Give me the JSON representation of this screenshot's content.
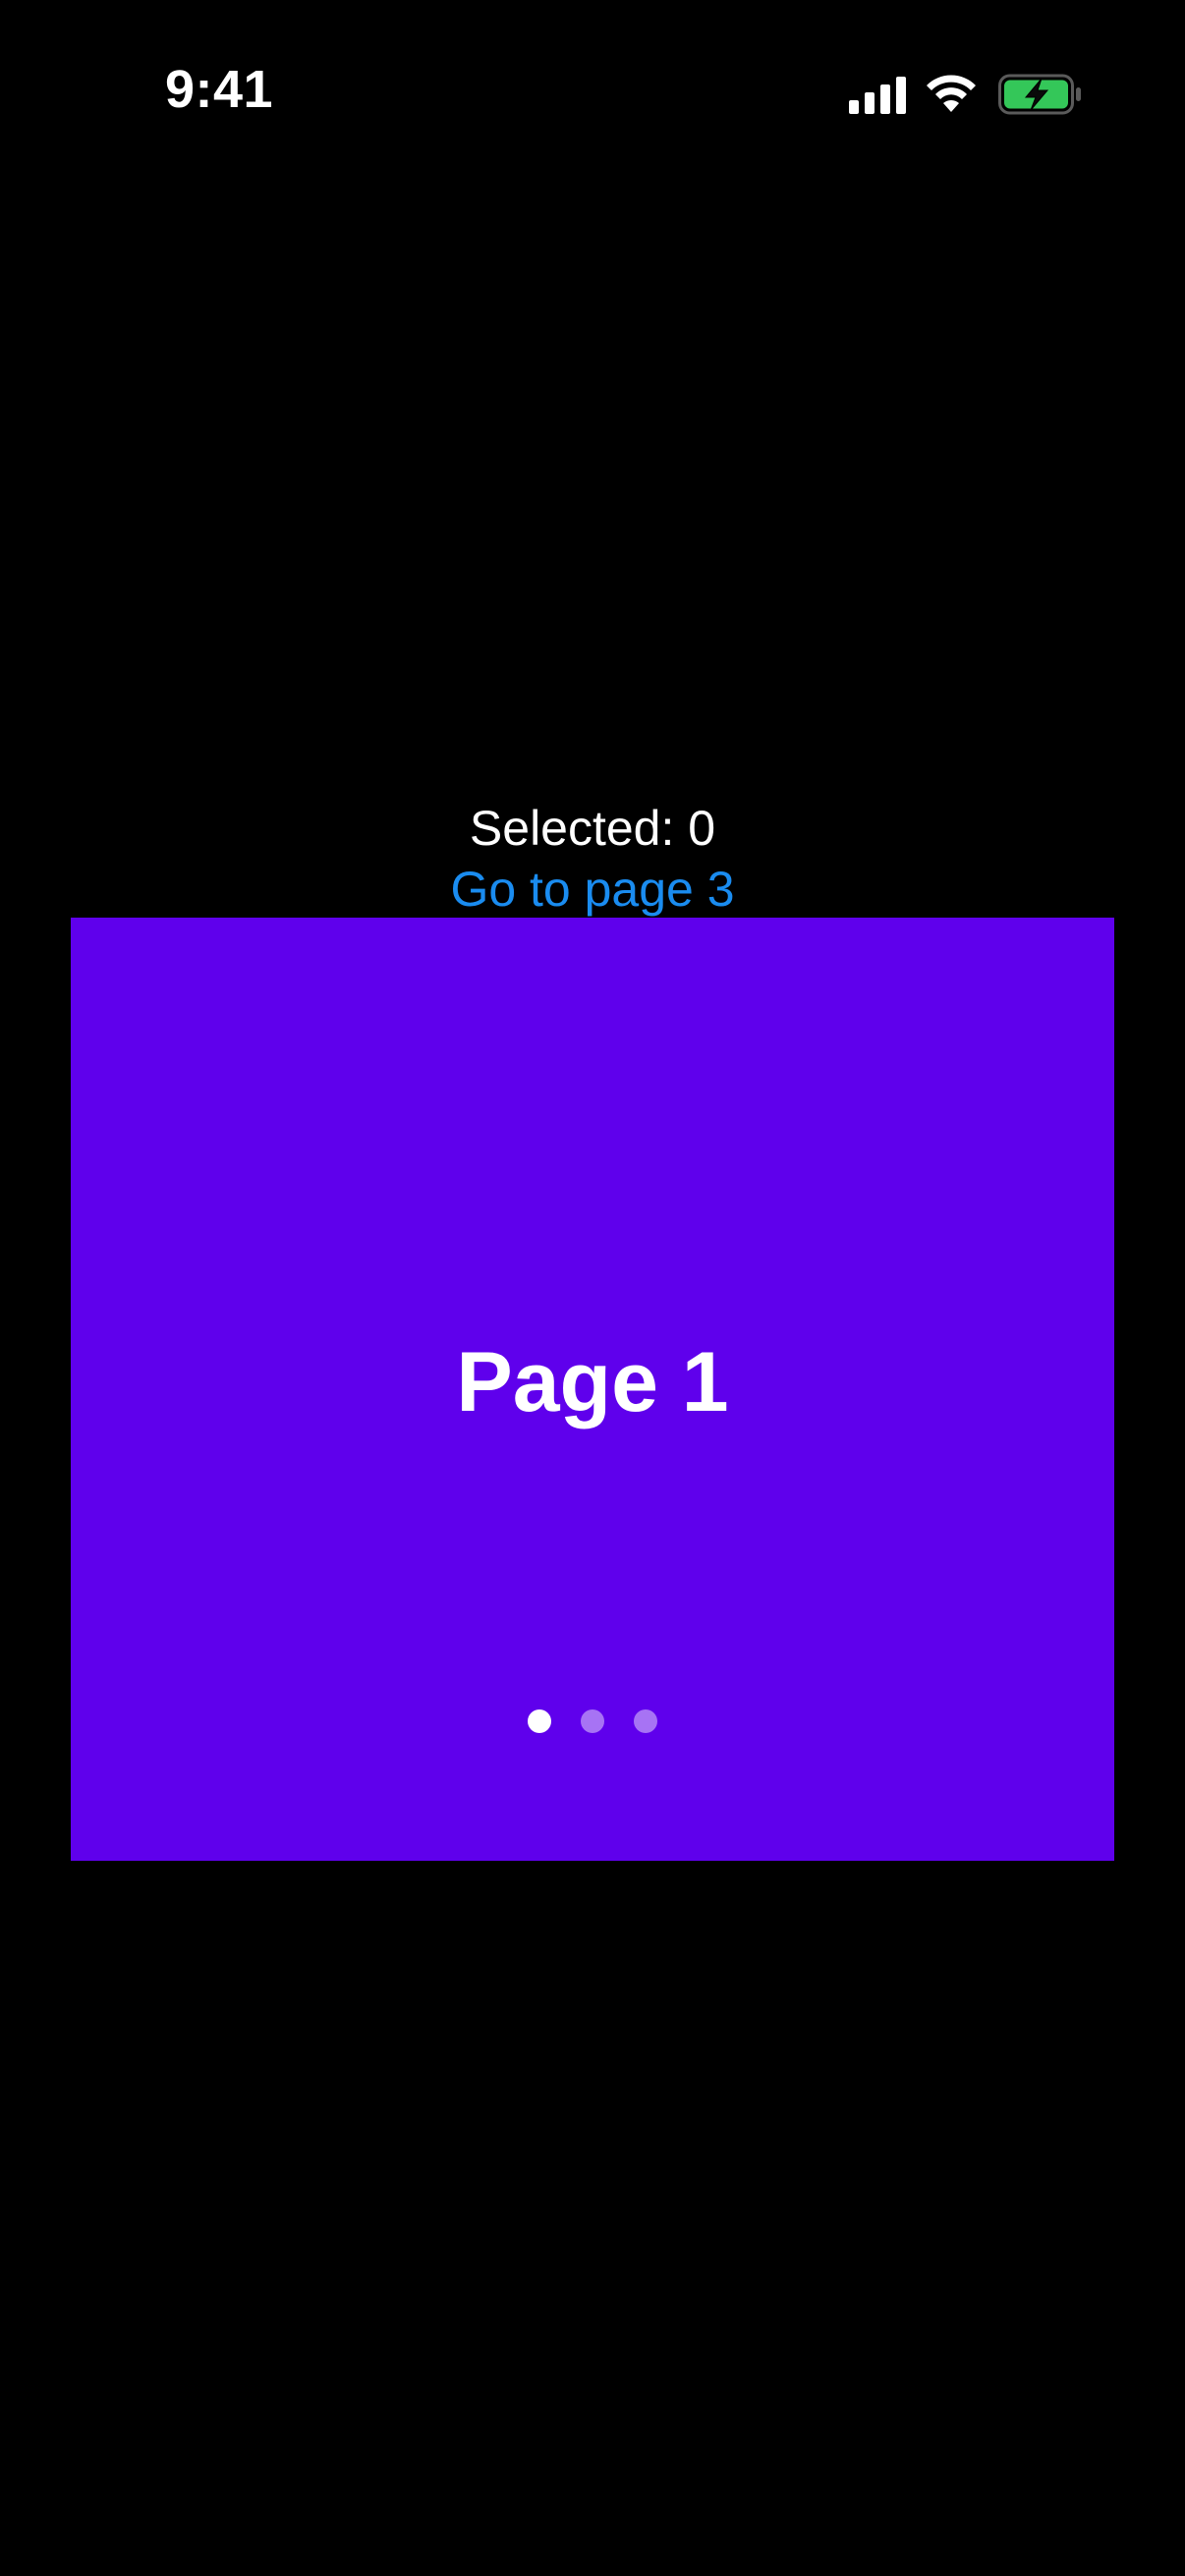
{
  "status_bar": {
    "time": "9:41",
    "battery_color": "#34c759"
  },
  "selected_label": "Selected: 0",
  "goto_link": "Go to page 3",
  "pager": {
    "background": "#5f00ec",
    "current_page_title": "Page 1",
    "page_count": 3,
    "active_index": 0
  }
}
